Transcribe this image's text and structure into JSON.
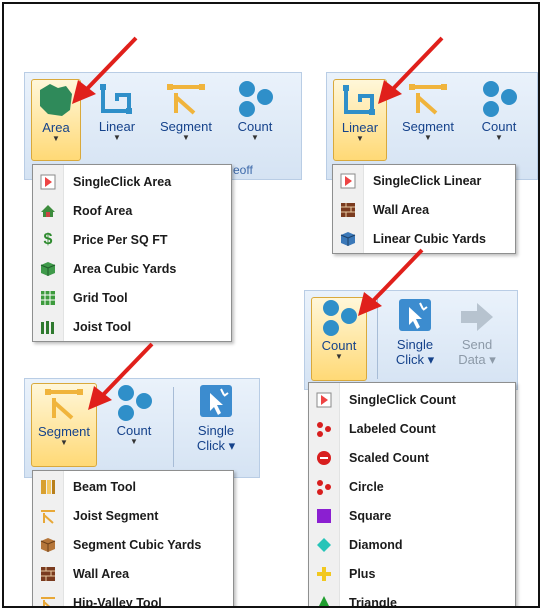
{
  "panel1": {
    "buttons": [
      {
        "label": "Area",
        "icon": "area-shape-icon"
      },
      {
        "label": "Linear",
        "icon": "linear-shape-icon"
      },
      {
        "label": "Segment",
        "icon": "segment-shape-icon"
      },
      {
        "label": "Count",
        "icon": "count-dots-icon"
      }
    ],
    "group_fragment": "eoff",
    "menu": [
      {
        "label": "SingleClick Area",
        "icon": "singleclick-cursor-icon"
      },
      {
        "label": "Roof Area",
        "icon": "roof-icon"
      },
      {
        "label": "Price Per SQ FT",
        "icon": "dollar-icon"
      },
      {
        "label": "Area Cubic Yards",
        "icon": "cube-icon"
      },
      {
        "label": "Grid Tool",
        "icon": "grid-icon"
      },
      {
        "label": "Joist Tool",
        "icon": "joist-icon"
      }
    ]
  },
  "panel2": {
    "buttons": [
      {
        "label": "Linear",
        "icon": "linear-shape-icon"
      },
      {
        "label": "Segment",
        "icon": "segment-shape-icon"
      },
      {
        "label": "Count",
        "icon": "count-dots-icon"
      }
    ],
    "menu": [
      {
        "label": "SingleClick Linear",
        "icon": "singleclick-cursor-icon"
      },
      {
        "label": "Wall Area",
        "icon": "brick-wall-icon"
      },
      {
        "label": "Linear Cubic Yards",
        "icon": "cube-icon"
      }
    ]
  },
  "panel3": {
    "buttons": [
      {
        "label": "Segment",
        "icon": "segment-shape-icon"
      },
      {
        "label": "Count",
        "icon": "count-dots-icon"
      },
      {
        "label_line1": "Single",
        "label_line2": "Click",
        "icon": "single-click-icon"
      }
    ],
    "menu": [
      {
        "label": "Beam Tool",
        "icon": "beam-icon"
      },
      {
        "label": "Joist Segment",
        "icon": "joist-segment-icon"
      },
      {
        "label": "Segment Cubic Yards",
        "icon": "cube-icon"
      },
      {
        "label": "Wall Area",
        "icon": "brick-wall-icon"
      },
      {
        "label": "Hip-Valley Tool",
        "icon": "hip-valley-icon"
      }
    ]
  },
  "panel4": {
    "buttons": [
      {
        "label": "Count",
        "icon": "count-dots-icon"
      },
      {
        "label_line1": "Single",
        "label_line2": "Click",
        "icon": "single-click-icon"
      },
      {
        "label_line1": "Send",
        "label_line2": "Data",
        "icon": "send-arrow-icon"
      }
    ],
    "menu": [
      {
        "label": "SingleClick Count",
        "icon": "singleclick-cursor-icon"
      },
      {
        "label": "Labeled Count",
        "icon": "labeled-dots-icon"
      },
      {
        "label": "Scaled Count",
        "icon": "red-ball-icon"
      },
      {
        "label": "Circle",
        "icon": "circle-dots-icon"
      },
      {
        "label": "Square",
        "icon": "square-icon"
      },
      {
        "label": "Diamond",
        "icon": "diamond-icon"
      },
      {
        "label": "Plus",
        "icon": "plus-icon"
      },
      {
        "label": "Triangle",
        "icon": "triangle-icon"
      }
    ]
  },
  "colors": {
    "accent_arrow": "#e0201b",
    "ribbon_text": "#15428b",
    "icon_blue": "#2f8fc9",
    "icon_orange": "#f0b43c",
    "icon_green": "#2f8a5a"
  }
}
